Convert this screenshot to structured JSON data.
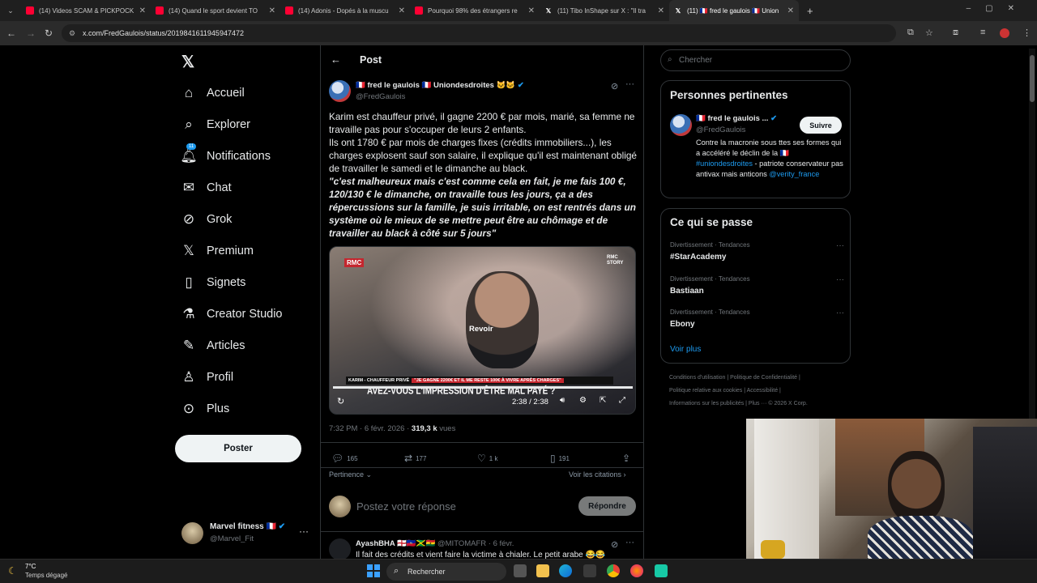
{
  "browser": {
    "tabs": [
      {
        "title": "(14) Videos SCAM & PICKPOCK",
        "icon": "youtube-icon"
      },
      {
        "title": "(14) Quand le sport devient TO",
        "icon": "youtube-icon"
      },
      {
        "title": "(14) Adonis - Dopés à la muscu",
        "icon": "youtube-icon"
      },
      {
        "title": "Pourquoi 98% des étrangers re",
        "icon": "youtube-icon"
      },
      {
        "title": "(11) Tibo InShape sur X : \"Il tra",
        "icon": "x-icon"
      },
      {
        "title": "(11) 🇫🇷 fred le gaulois 🇫🇷 Union",
        "icon": "x-icon"
      }
    ],
    "url": "x.com/FredGaulois/status/2019841611945947472"
  },
  "nav": {
    "items": [
      {
        "label": "Accueil",
        "icon": "home-icon"
      },
      {
        "label": "Explorer",
        "icon": "search-icon"
      },
      {
        "label": "Notifications",
        "icon": "bell-icon",
        "badge": "11"
      },
      {
        "label": "Chat",
        "icon": "mail-icon"
      },
      {
        "label": "Grok",
        "icon": "grok-icon"
      },
      {
        "label": "Premium",
        "icon": "x-logo-icon"
      },
      {
        "label": "Signets",
        "icon": "bookmark-icon"
      },
      {
        "label": "Creator Studio",
        "icon": "flask-icon"
      },
      {
        "label": "Articles",
        "icon": "article-icon"
      },
      {
        "label": "Profil",
        "icon": "person-icon"
      },
      {
        "label": "Plus",
        "icon": "more-circle-icon"
      }
    ],
    "post_button": "Poster",
    "account": {
      "name": "Marvel fitness 🇫🇷",
      "handle": "@Marvel_Fit"
    }
  },
  "post": {
    "header": "Post",
    "author_name": "🇫🇷 fred le gaulois 🇫🇷 Uniondesdroites 🐱🐱",
    "author_handle": "@FredGaulois",
    "text_p1": "Karim est chauffeur privé, il gagne 2200 € par mois, marié, sa femme ne travaille pas pour s'occuper de leurs 2 enfants.",
    "text_p2": "Ils ont 1780 € par mois de charges fixes (crédits immobiliers...), les charges explosent sauf son salaire, il explique qu'il est maintenant obligé de travailler le samedi et le dimanche au black.",
    "text_quote": "\"c'est malheureux mais c'est comme cela en fait, je me fais 100 €, 120/130 € le dimanche, on travaille tous les jours, ça a des répercussions sur la famille, je suis irritable, on est rentrés dans un système où le mieux de se mettre peut être au chômage et de travailler au black à côté sur 5 jours\"",
    "video": {
      "replay_label": "Revoir",
      "time": "2:38 / 2:38",
      "channel": "RMC",
      "channel2": "RMC STORY",
      "banner_name": "KARIM - CHAUFFEUR PRIVÉ",
      "banner_quote": "\"JE GAGNE 2200€ ET IL ME RESTE 100€ À VIVRE APRÈS CHARGES\"",
      "headline": "AVEZ-VOUS L'IMPRESSION D'ÊTRE MAL PAYÉ ?"
    },
    "timestamp": "7:32 PM · 6 févr. 2026 · ",
    "views_count": "319,3 k",
    "views_label": " vues",
    "metrics": {
      "replies": "165",
      "reposts": "177",
      "likes": "1 k",
      "bookmarks": "191"
    },
    "relevance_label": "Pertinence",
    "quotes_link": "Voir les citations",
    "reply_placeholder": "Postez votre réponse",
    "reply_button": "Répondre"
  },
  "reply": {
    "author_name": "AyashBHA 🏴󠁧󠁢󠁥󠁮󠁧󠁿🇭🇹🇯🇲🇬🇭",
    "author_handle": "@MITOMAFR · 6 févr.",
    "text": "Il fait des crédits et vient faire la victime à chialer. Le petit arabe 😂😂"
  },
  "right": {
    "search_placeholder": "Chercher",
    "relevant": {
      "title": "Personnes pertinentes",
      "name": "🇫🇷 fred le gaulois ...",
      "handle": "@FredGaulois",
      "follow": "Suivre",
      "bio_1": "Contre la macronie sous ttes ses formes qui a accéléré le déclin de la 🇫🇷 ",
      "bio_tag": "#uniondesdroites",
      "bio_2": " - patriote conservateur pas antivax mais anticons ",
      "bio_mention": "@verity_france"
    },
    "trends": {
      "title": "Ce qui se passe",
      "items": [
        {
          "category": "Divertissement · Tendances",
          "name": "#StarAcademy"
        },
        {
          "category": "Divertissement · Tendances",
          "name": "Bastiaan"
        },
        {
          "category": "Divertissement · Tendances",
          "name": "Ebony"
        }
      ],
      "more": "Voir plus"
    },
    "footer": {
      "l1": "Conditions d'utilisation  |   Politique de Confidentialité  |",
      "l2": "Politique relative aux cookies  |   Accessibilité  |",
      "l3": "Informations sur les publicités  |   Plus ···   © 2026 X Corp."
    }
  },
  "taskbar": {
    "weather_temp": "7°C",
    "weather_desc": "Temps dégagé",
    "search_label": "Rechercher"
  }
}
